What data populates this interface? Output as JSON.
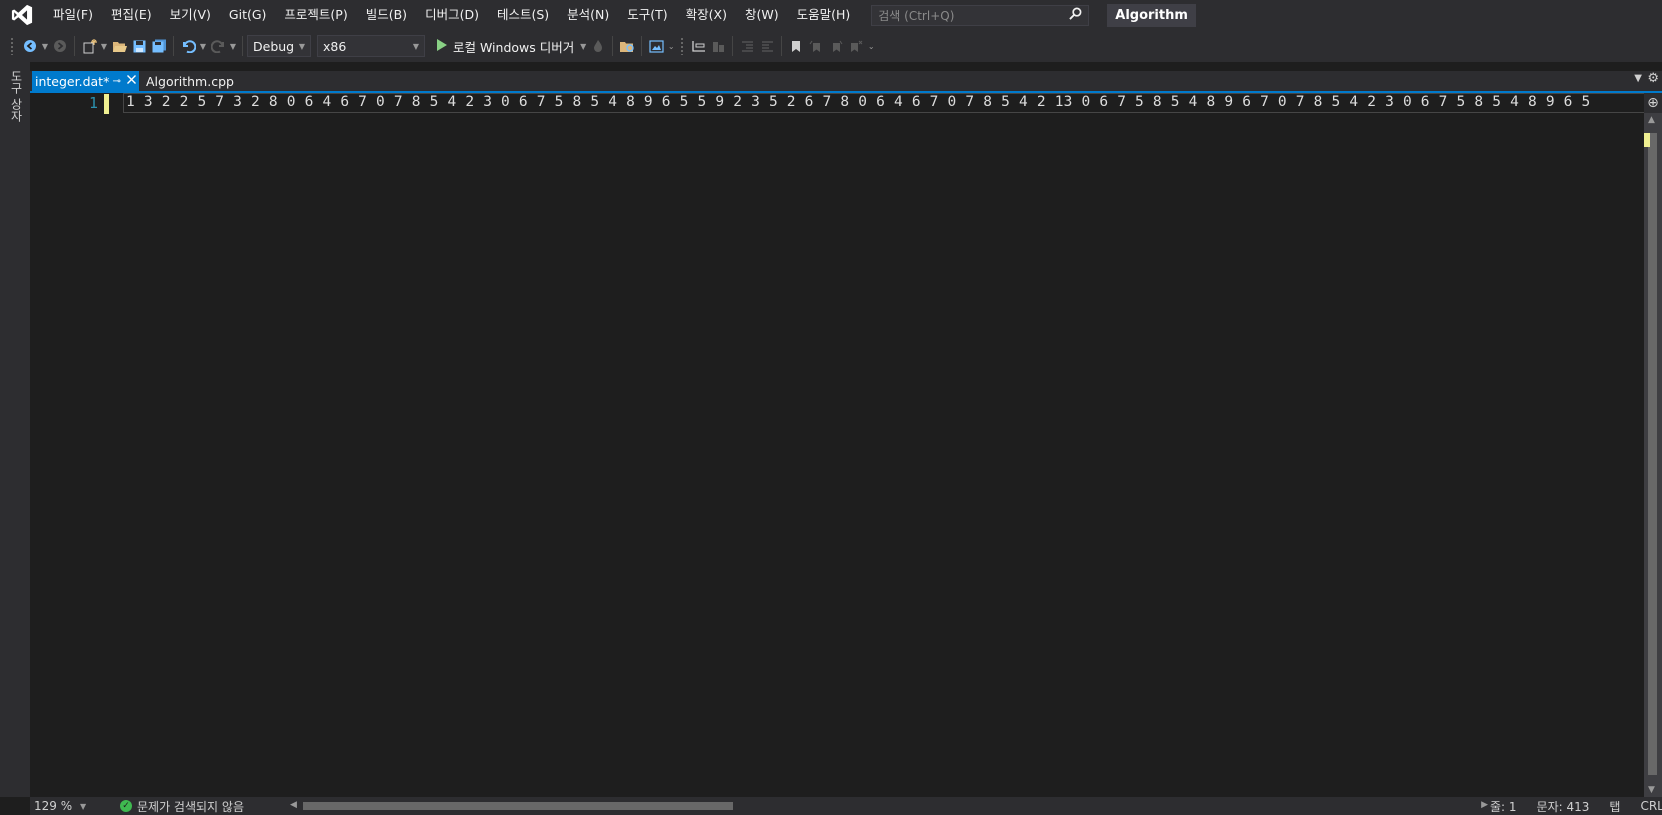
{
  "app": {
    "solution_name": "Algorithm"
  },
  "menu": {
    "items": [
      {
        "label": "파일(F)"
      },
      {
        "label": "편집(E)"
      },
      {
        "label": "보기(V)"
      },
      {
        "label": "Git(G)"
      },
      {
        "label": "프로젝트(P)"
      },
      {
        "label": "빌드(B)"
      },
      {
        "label": "디버그(D)"
      },
      {
        "label": "테스트(S)"
      },
      {
        "label": "분석(N)"
      },
      {
        "label": "도구(T)"
      },
      {
        "label": "확장(X)"
      },
      {
        "label": "창(W)"
      },
      {
        "label": "도움말(H)"
      }
    ]
  },
  "search": {
    "placeholder": "검색 (Ctrl+Q)"
  },
  "toolbar": {
    "configuration": "Debug",
    "platform": "x86",
    "run_label": "로컬 Windows 디버거"
  },
  "left_rail": {
    "toolbox_label": "도구 상자"
  },
  "tabs": {
    "active": {
      "label": "integer.dat*"
    },
    "inactive": {
      "label": "Algorithm.cpp"
    }
  },
  "editor": {
    "line_number": "1",
    "content": "1 3 2 2 5 7 3 2 8 0 6 4 6 7 0 7 8 5 4 2 3 0 6 7 5 8 5 4 8 9 6 5 5 9 2 3 5 2 6 7 8 0 6 4 6 7 0 7 8 5 4 2 13 0 6 7 5 8 5 4 8 9 6 7 0 7 8 5 4 2 3 0 6 7 5 8 5 4 8 9 6 5"
  },
  "status": {
    "zoom": "129 %",
    "issues": "문제가 검색되지 않음",
    "line": "줄: 1",
    "char": "문자: 413",
    "indent": "탭",
    "eol": "CRLF"
  },
  "colors": {
    "accent": "#007acc",
    "chrome": "#2d2d30",
    "editor_bg": "#1e1e1e",
    "line_number": "#2b91af",
    "change_marker": "#efef91"
  }
}
